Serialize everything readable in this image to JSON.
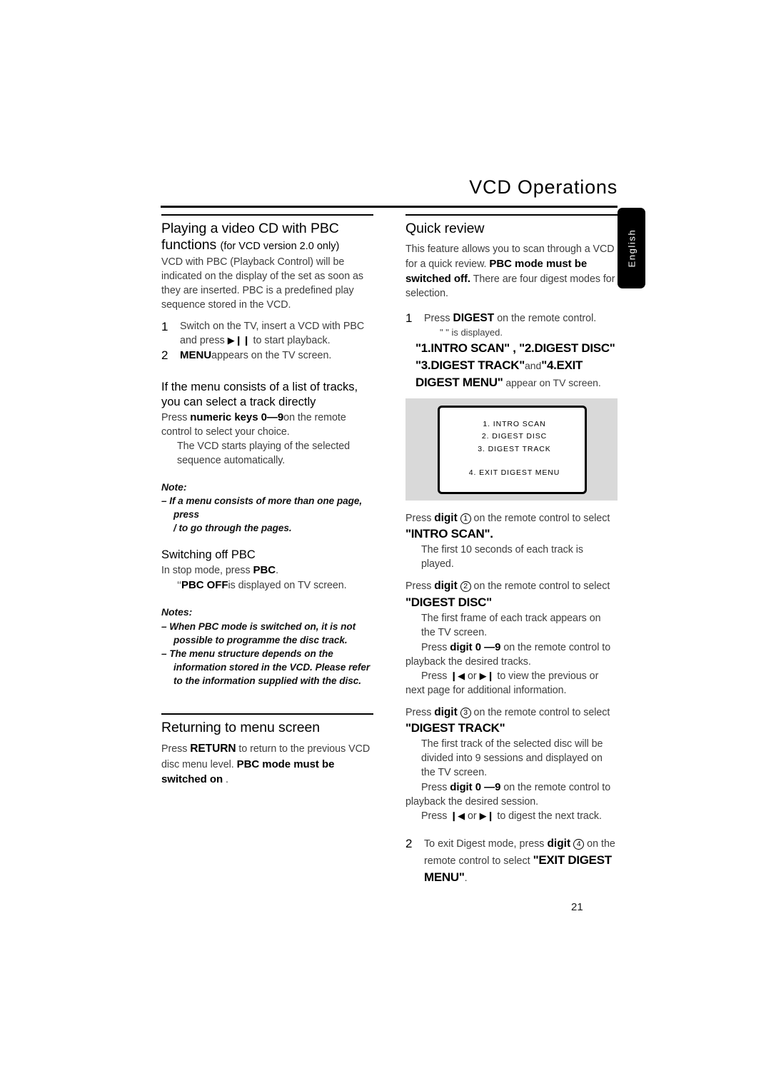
{
  "page": {
    "title": "VCD Operations",
    "number": "21",
    "side_tab": "English"
  },
  "left_column": {
    "section1": {
      "heading": "Playing a video CD with PBC",
      "heading_line2": "functions",
      "heading_note": "(for VCD version 2.0 only)",
      "intro": "VCD with PBC (Playback Control) will be indicated on the display of the set as soon as they are inserted. PBC is a predefined play sequence stored in the VCD.",
      "steps": [
        {
          "num": "1",
          "text_a": "Switch on the TV, insert a VCD with PBC and press ",
          "glyph": "▶❙❙",
          "text_b": " to start playback."
        },
        {
          "num": "2",
          "bold": "MENU",
          "text": "appears on the TV screen."
        }
      ],
      "subhead": "If the menu consists of a list of tracks, you can select a track directly",
      "body_a_pre": "Press ",
      "body_a_bold": "numeric keys 0—9",
      "body_a_post": "on the remote control to select your choice.",
      "body_b": "The VCD starts playing of the selected sequence automatically.",
      "note_label": "Note:",
      "note_items": [
        "–  If a menu consists of more than one page, press",
        "/      to go through the pages."
      ]
    },
    "section2": {
      "heading": "Switching off PBC",
      "line1_pre": "In stop mode, press ",
      "line1_bold": "PBC",
      "line1_post": ".",
      "line2_pre": "‘‘",
      "line2_bold": "PBC OFF",
      "line2_post": "is displayed on TV screen.",
      "notes_label": "Notes:",
      "notes_items": [
        "–  When PBC mode is switched on, it is not possible to programme the disc track.",
        "–  The menu structure depends on the information stored in the VCD. Please refer to the information supplied with the disc."
      ]
    },
    "section3": {
      "heading": "Returning to menu screen",
      "body_pre": "Press ",
      "body_bold1": "RETURN",
      "body_mid": " to return to the previous VCD disc menu level. ",
      "body_bold2": "PBC mode must be switched on",
      "body_post": " ."
    }
  },
  "right_column": {
    "section1": {
      "heading": "Quick review",
      "intro_a": "This feature allows you to scan through a VCD for a quick review. ",
      "intro_bold": "PBC mode must be switched off.",
      "intro_b": "  There are four digest modes for selection.",
      "step1": {
        "num": "1",
        "line1_pre": "Press ",
        "line1_bold": "DIGEST",
        "line1_post": " on the remote control.",
        "line2": "\"              \" is displayed.",
        "line3_bold": "\"1.INTRO SCAN\" , \"2.DIGEST DISC\" \"3.DIGEST TRACK\"",
        "line3_mid": "and",
        "line3_bold2": "\"4.EXIT DIGEST MENU\"",
        "line3_post": " appear on TV screen."
      },
      "tv_screen": {
        "items": [
          "1. INTRO SCAN",
          "2. DIGEST DISC",
          "3. DIGEST TRACK",
          "4. EXIT DIGEST MENU"
        ]
      },
      "digest_modes": [
        {
          "press_pre": "Press ",
          "press_bold": "digit",
          "circle": "1",
          "press_post": " on the remote control to select",
          "mode_name": "\"INTRO SCAN\".",
          "detail": "The first 10 seconds of each track is played.",
          "extra": []
        },
        {
          "press_pre": "Press ",
          "press_bold": "digit",
          "circle": "2",
          "press_post": " on the remote control to select",
          "mode_name": "\"DIGEST DISC\"",
          "detail": "The first frame of each track appears on the TV screen.",
          "extra": [
            {
              "pre": "Press ",
              "bold": "digit 0 —9",
              "post": " on the remote control to playback the desired tracks."
            },
            {
              "pre": "Press ",
              "glyph_a": "❙◀",
              "mid": " or ",
              "glyph_b": "▶❙",
              "post": " to view the previous or next page for additional information."
            }
          ]
        },
        {
          "press_pre": "Press ",
          "press_bold": "digit",
          "circle": "3",
          "press_post": " on the remote control to select",
          "mode_name": "\"DIGEST TRACK\"",
          "detail": "The first track of the selected disc will be divided into 9 sessions and displayed on the TV screen.",
          "extra": [
            {
              "pre": "Press ",
              "bold": "digit 0 —9",
              "post": " on the remote control to playback the desired session."
            },
            {
              "pre": "Press ",
              "glyph_a": "❙◀",
              "mid": " or ",
              "glyph_b": "▶❙",
              "post": " to digest the next track."
            }
          ]
        }
      ],
      "step2": {
        "num": "2",
        "text_pre": "To exit Digest mode, press ",
        "text_bold": "digit",
        "circle": "4",
        "text_mid": " on the remote control to select ",
        "text_bold2": "\"EXIT DIGEST MENU\"",
        "text_post": "."
      }
    }
  }
}
